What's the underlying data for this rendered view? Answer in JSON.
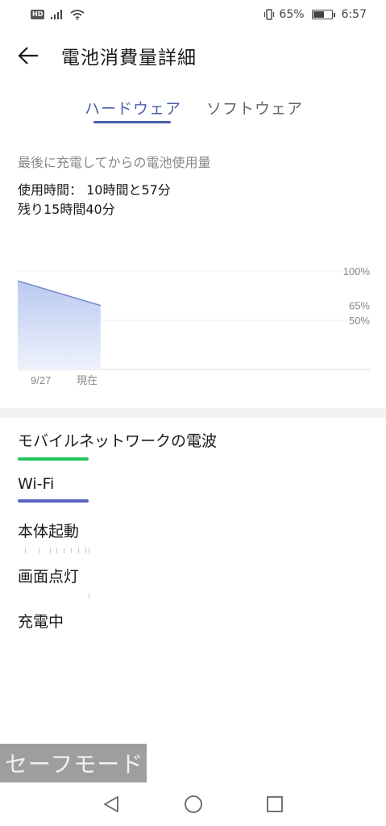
{
  "status_bar": {
    "hd_label": "HD",
    "battery_text": "65%",
    "battery_level": 0.65,
    "time": "6:57"
  },
  "app_bar": {
    "title": "電池消費量詳細"
  },
  "tabs": [
    {
      "label": "ハードウェア",
      "selected": true
    },
    {
      "label": "ソフトウェア",
      "selected": false
    }
  ],
  "accent_color": "#4b5fa8",
  "usage": {
    "section_label": "最後に充電してからの電池使用量",
    "usage_time": "使用時間： 10時間と57分",
    "remaining": "残り15時間40分"
  },
  "chart_data": {
    "type": "area",
    "x_tick_labels": [
      "9/27",
      "現在"
    ],
    "y_tick_labels": [
      "100%",
      "65%",
      "50%"
    ],
    "y_gridlines": [
      100,
      50
    ],
    "ylim": [
      0,
      100
    ],
    "series": [
      {
        "values": [
          {
            "x": 0,
            "y": 90
          },
          {
            "x": 1,
            "y": 65
          }
        ],
        "color": "#6f86c9"
      }
    ],
    "x_range": [
      0,
      4.25
    ],
    "grid": true
  },
  "legend": [
    {
      "label": "モバイルネットワークの電波",
      "color": "#22c35e",
      "bar_fraction": 0.2
    },
    {
      "label": "Wi-Fi",
      "color": "#5b62c3",
      "bar_fraction": 0.2
    },
    {
      "label": "本体起動",
      "color": "#c7c7d6",
      "ticks": [
        0.02,
        0.06,
        0.09,
        0.11,
        0.13,
        0.15,
        0.17,
        0.19,
        0.2
      ]
    },
    {
      "label": "画面点灯",
      "color": "#c7c7d6",
      "ticks": [
        0.2
      ]
    },
    {
      "label": "充電中",
      "color": "#c7c7d6",
      "ticks": []
    }
  ],
  "overlay": {
    "safe_mode": "セーフモード"
  },
  "nav_bar": {
    "back": "back-icon",
    "home": "home-icon",
    "recents": "recents-icon"
  }
}
